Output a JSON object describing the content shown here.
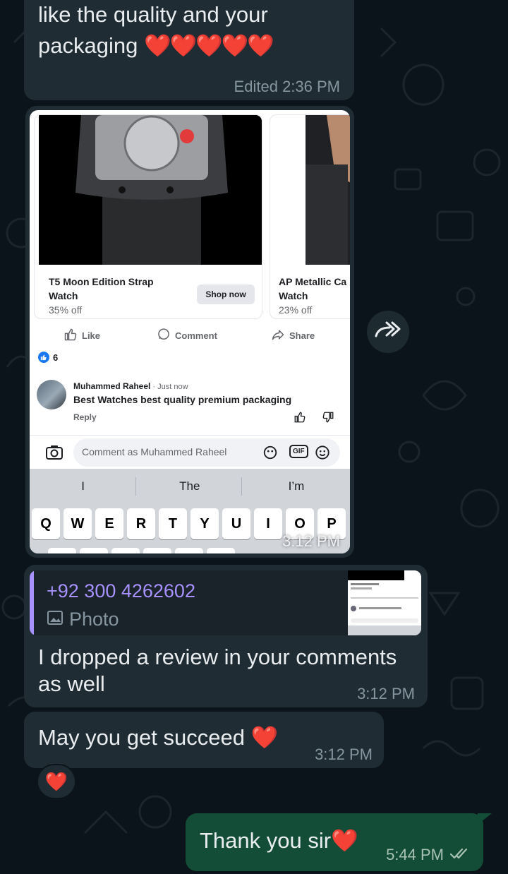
{
  "messages": {
    "top": {
      "text_line1": "like the quality and your",
      "text_line2": "packaging",
      "hearts": "❤️❤️❤️❤️❤️",
      "edited": "Edited",
      "time": "2:36 PM"
    },
    "screenshot": {
      "time": "3:12 PM",
      "fb": {
        "products": [
          {
            "name": "T5 Moon Edition Strap Watch",
            "discount": "35% off",
            "button": "Shop now"
          },
          {
            "name": "AP Metallic Ca Watch",
            "discount": "23% off"
          }
        ],
        "actions": {
          "like": "Like",
          "comment": "Comment",
          "share": "Share"
        },
        "likes_count": "6",
        "comment": {
          "author": "Muhammed Raheel",
          "time": " · Just now",
          "text": "Best Watches best quality premium packaging",
          "reply": "Reply"
        },
        "input_placeholder": "Comment as Muhammed Raheel",
        "gif_label": "GIF",
        "suggestions": [
          "I",
          "The",
          "I’m"
        ],
        "keys": [
          "Q",
          "W",
          "E",
          "R",
          "T",
          "Y",
          "U",
          "I",
          "O",
          "P"
        ]
      }
    },
    "review": {
      "quote_name": "+92 300 4262602",
      "quote_sub": "Photo",
      "text_line1": "I dropped a review in your comments",
      "text_line2": "as well",
      "time": "3:12 PM"
    },
    "succeed": {
      "text": "May you get succeed",
      "emoji": "❤️",
      "time": "3:12 PM",
      "reaction": "❤️"
    },
    "thanks": {
      "text": "Thank you sir",
      "emoji": "❤️",
      "time": "5:44 PM",
      "status": "read"
    }
  },
  "icons": {
    "forward": "forward-icon",
    "photo": "photo-icon",
    "read": "double-check-icon"
  },
  "colors": {
    "background": "#0b141a",
    "incoming_bubble": "#202c33",
    "outgoing_bubble": "#144d37",
    "quote_accent": "#a791ff",
    "meta_text": "#8696a0"
  }
}
